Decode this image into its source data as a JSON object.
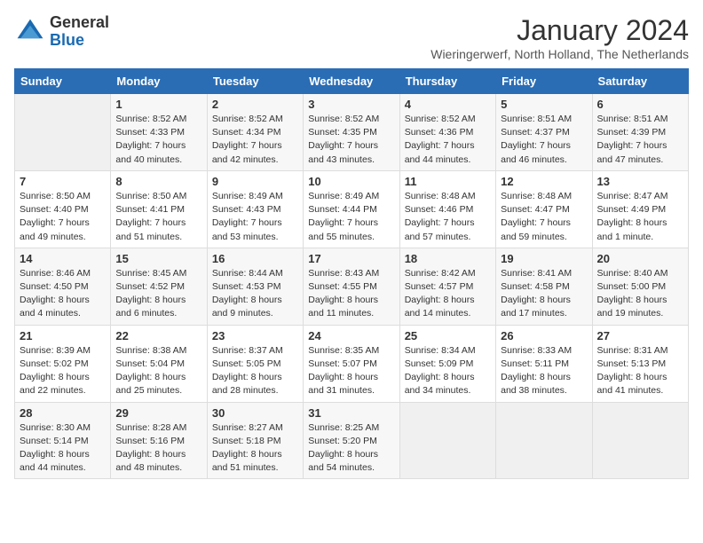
{
  "logo": {
    "general": "General",
    "blue": "Blue"
  },
  "title": "January 2024",
  "location": "Wieringerwerf, North Holland, The Netherlands",
  "days_of_week": [
    "Sunday",
    "Monday",
    "Tuesday",
    "Wednesday",
    "Thursday",
    "Friday",
    "Saturday"
  ],
  "weeks": [
    [
      {
        "day": "",
        "sunrise": "",
        "sunset": "",
        "daylight": ""
      },
      {
        "day": "1",
        "sunrise": "Sunrise: 8:52 AM",
        "sunset": "Sunset: 4:33 PM",
        "daylight": "Daylight: 7 hours and 40 minutes."
      },
      {
        "day": "2",
        "sunrise": "Sunrise: 8:52 AM",
        "sunset": "Sunset: 4:34 PM",
        "daylight": "Daylight: 7 hours and 42 minutes."
      },
      {
        "day": "3",
        "sunrise": "Sunrise: 8:52 AM",
        "sunset": "Sunset: 4:35 PM",
        "daylight": "Daylight: 7 hours and 43 minutes."
      },
      {
        "day": "4",
        "sunrise": "Sunrise: 8:52 AM",
        "sunset": "Sunset: 4:36 PM",
        "daylight": "Daylight: 7 hours and 44 minutes."
      },
      {
        "day": "5",
        "sunrise": "Sunrise: 8:51 AM",
        "sunset": "Sunset: 4:37 PM",
        "daylight": "Daylight: 7 hours and 46 minutes."
      },
      {
        "day": "6",
        "sunrise": "Sunrise: 8:51 AM",
        "sunset": "Sunset: 4:39 PM",
        "daylight": "Daylight: 7 hours and 47 minutes."
      }
    ],
    [
      {
        "day": "7",
        "sunrise": "Sunrise: 8:50 AM",
        "sunset": "Sunset: 4:40 PM",
        "daylight": "Daylight: 7 hours and 49 minutes."
      },
      {
        "day": "8",
        "sunrise": "Sunrise: 8:50 AM",
        "sunset": "Sunset: 4:41 PM",
        "daylight": "Daylight: 7 hours and 51 minutes."
      },
      {
        "day": "9",
        "sunrise": "Sunrise: 8:49 AM",
        "sunset": "Sunset: 4:43 PM",
        "daylight": "Daylight: 7 hours and 53 minutes."
      },
      {
        "day": "10",
        "sunrise": "Sunrise: 8:49 AM",
        "sunset": "Sunset: 4:44 PM",
        "daylight": "Daylight: 7 hours and 55 minutes."
      },
      {
        "day": "11",
        "sunrise": "Sunrise: 8:48 AM",
        "sunset": "Sunset: 4:46 PM",
        "daylight": "Daylight: 7 hours and 57 minutes."
      },
      {
        "day": "12",
        "sunrise": "Sunrise: 8:48 AM",
        "sunset": "Sunset: 4:47 PM",
        "daylight": "Daylight: 7 hours and 59 minutes."
      },
      {
        "day": "13",
        "sunrise": "Sunrise: 8:47 AM",
        "sunset": "Sunset: 4:49 PM",
        "daylight": "Daylight: 8 hours and 1 minute."
      }
    ],
    [
      {
        "day": "14",
        "sunrise": "Sunrise: 8:46 AM",
        "sunset": "Sunset: 4:50 PM",
        "daylight": "Daylight: 8 hours and 4 minutes."
      },
      {
        "day": "15",
        "sunrise": "Sunrise: 8:45 AM",
        "sunset": "Sunset: 4:52 PM",
        "daylight": "Daylight: 8 hours and 6 minutes."
      },
      {
        "day": "16",
        "sunrise": "Sunrise: 8:44 AM",
        "sunset": "Sunset: 4:53 PM",
        "daylight": "Daylight: 8 hours and 9 minutes."
      },
      {
        "day": "17",
        "sunrise": "Sunrise: 8:43 AM",
        "sunset": "Sunset: 4:55 PM",
        "daylight": "Daylight: 8 hours and 11 minutes."
      },
      {
        "day": "18",
        "sunrise": "Sunrise: 8:42 AM",
        "sunset": "Sunset: 4:57 PM",
        "daylight": "Daylight: 8 hours and 14 minutes."
      },
      {
        "day": "19",
        "sunrise": "Sunrise: 8:41 AM",
        "sunset": "Sunset: 4:58 PM",
        "daylight": "Daylight: 8 hours and 17 minutes."
      },
      {
        "day": "20",
        "sunrise": "Sunrise: 8:40 AM",
        "sunset": "Sunset: 5:00 PM",
        "daylight": "Daylight: 8 hours and 19 minutes."
      }
    ],
    [
      {
        "day": "21",
        "sunrise": "Sunrise: 8:39 AM",
        "sunset": "Sunset: 5:02 PM",
        "daylight": "Daylight: 8 hours and 22 minutes."
      },
      {
        "day": "22",
        "sunrise": "Sunrise: 8:38 AM",
        "sunset": "Sunset: 5:04 PM",
        "daylight": "Daylight: 8 hours and 25 minutes."
      },
      {
        "day": "23",
        "sunrise": "Sunrise: 8:37 AM",
        "sunset": "Sunset: 5:05 PM",
        "daylight": "Daylight: 8 hours and 28 minutes."
      },
      {
        "day": "24",
        "sunrise": "Sunrise: 8:35 AM",
        "sunset": "Sunset: 5:07 PM",
        "daylight": "Daylight: 8 hours and 31 minutes."
      },
      {
        "day": "25",
        "sunrise": "Sunrise: 8:34 AM",
        "sunset": "Sunset: 5:09 PM",
        "daylight": "Daylight: 8 hours and 34 minutes."
      },
      {
        "day": "26",
        "sunrise": "Sunrise: 8:33 AM",
        "sunset": "Sunset: 5:11 PM",
        "daylight": "Daylight: 8 hours and 38 minutes."
      },
      {
        "day": "27",
        "sunrise": "Sunrise: 8:31 AM",
        "sunset": "Sunset: 5:13 PM",
        "daylight": "Daylight: 8 hours and 41 minutes."
      }
    ],
    [
      {
        "day": "28",
        "sunrise": "Sunrise: 8:30 AM",
        "sunset": "Sunset: 5:14 PM",
        "daylight": "Daylight: 8 hours and 44 minutes."
      },
      {
        "day": "29",
        "sunrise": "Sunrise: 8:28 AM",
        "sunset": "Sunset: 5:16 PM",
        "daylight": "Daylight: 8 hours and 48 minutes."
      },
      {
        "day": "30",
        "sunrise": "Sunrise: 8:27 AM",
        "sunset": "Sunset: 5:18 PM",
        "daylight": "Daylight: 8 hours and 51 minutes."
      },
      {
        "day": "31",
        "sunrise": "Sunrise: 8:25 AM",
        "sunset": "Sunset: 5:20 PM",
        "daylight": "Daylight: 8 hours and 54 minutes."
      },
      {
        "day": "",
        "sunrise": "",
        "sunset": "",
        "daylight": ""
      },
      {
        "day": "",
        "sunrise": "",
        "sunset": "",
        "daylight": ""
      },
      {
        "day": "",
        "sunrise": "",
        "sunset": "",
        "daylight": ""
      }
    ]
  ]
}
